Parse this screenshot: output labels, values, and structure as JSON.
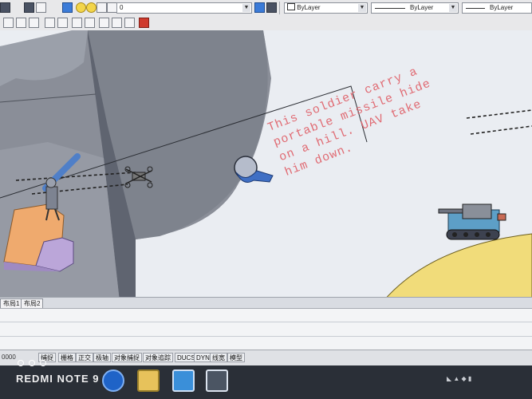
{
  "toolbar_top": {
    "layer_value": "0",
    "color_combo": "ByLayer",
    "linetype_combo": "ByLayer",
    "lineweight_combo": "ByLayer"
  },
  "drawing": {
    "note_lines": [
      "This soldier carry a",
      "portable missile hide",
      "on a hill. UAV take",
      "him down."
    ],
    "shading_colors": {
      "background": "#eaedf2",
      "hill_shadow": "#878b95",
      "ground_hill": "#f1dc7a",
      "soldier_step": "#efaa6e",
      "step_side": "#bba6d9",
      "soldier_missile": "#4f7fc8"
    }
  },
  "layout_tabs": [
    "布局1",
    "布局2"
  ],
  "command": {
    "coordinates": "0000"
  },
  "status_buttons": [
    "捕捉",
    "栅格",
    "正交",
    "极轴",
    "对象捕捉",
    "对象追踪",
    "DUCS",
    "DYN",
    "线宽",
    "模型"
  ],
  "taskbar": {
    "watermark": "REDMI NOTE 9",
    "apps": [
      "ie-icon",
      "folder-icon",
      "store-icon",
      "cad-app-icon"
    ]
  }
}
